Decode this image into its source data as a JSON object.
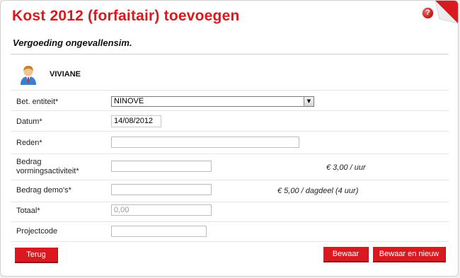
{
  "header": {
    "title": "Kost 2012 (forfaitair) toevoegen",
    "subtitle": "Vergoeding ongevallensim.",
    "help_icon_glyph": "?"
  },
  "user": {
    "name": "VIVIANE",
    "icon": "user-icon"
  },
  "form": {
    "entity": {
      "label": "Bet. entiteit*",
      "value": "NINOVE"
    },
    "date": {
      "label": "Datum*",
      "value": "14/08/2012"
    },
    "reason": {
      "label": "Reden*",
      "value": ""
    },
    "training": {
      "label_line1": "Bedrag",
      "label_line2": "vormingsactiviteit*",
      "value": "",
      "rate": "€ 3,00 / uur"
    },
    "demos": {
      "label": "Bedrag demo's*",
      "value": "",
      "rate": "€ 5,00 / dagdeel (4 uur)"
    },
    "total": {
      "label": "Totaal*",
      "value": "0,00"
    },
    "project": {
      "label": "Projectcode",
      "value": ""
    }
  },
  "buttons": {
    "back": "Terug",
    "save": "Bewaar",
    "save_new": "Bewaar en nieuw"
  },
  "colors": {
    "accent": "#d9181f",
    "divider": "#e3e3e3"
  }
}
